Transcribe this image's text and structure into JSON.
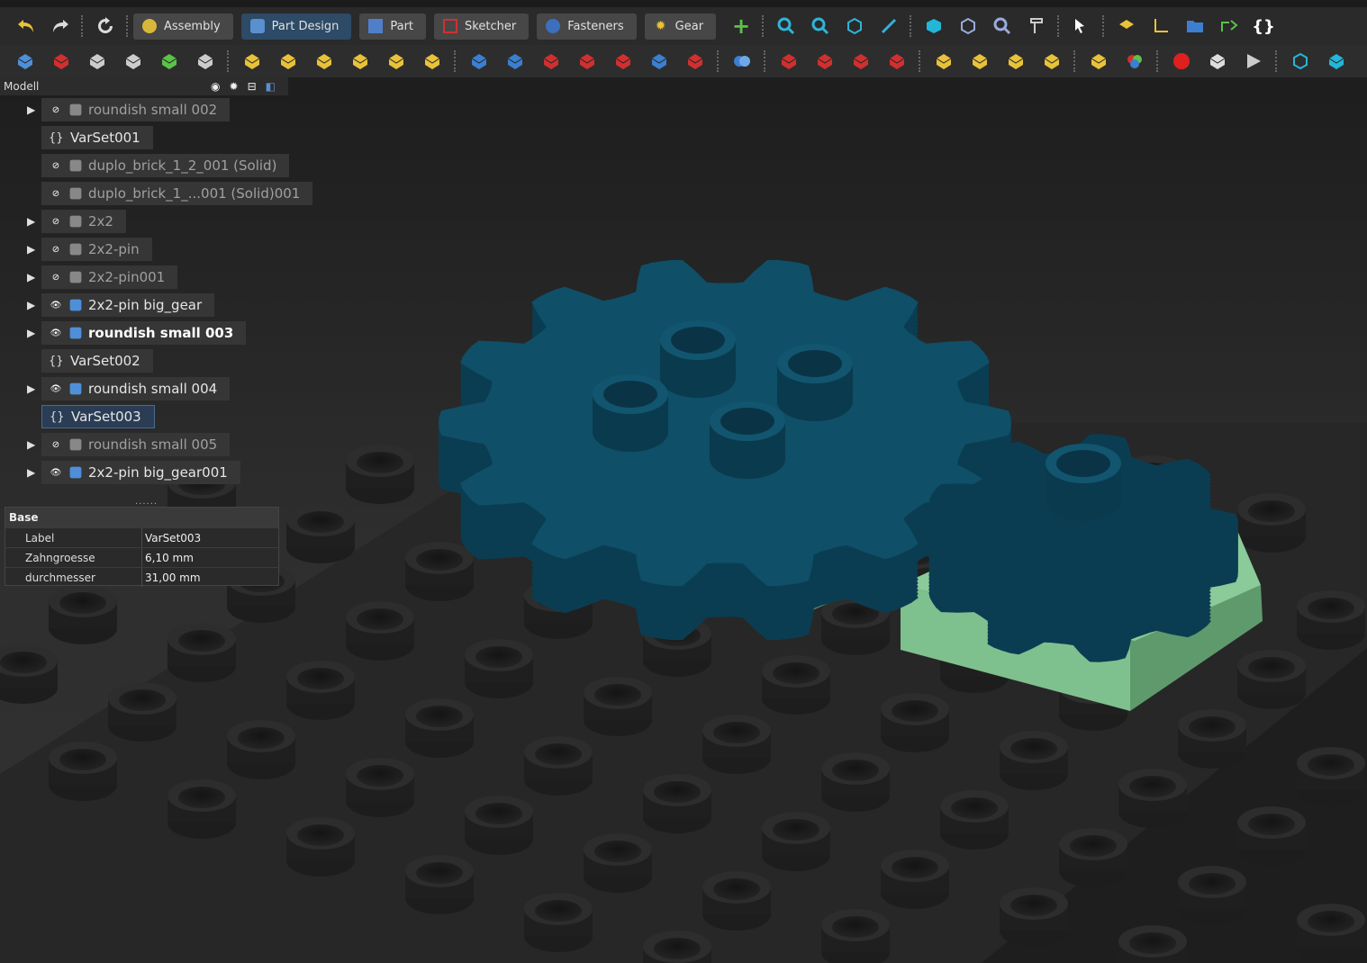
{
  "workbenches": [
    {
      "label": "Assembly",
      "active": false
    },
    {
      "label": "Part Design",
      "active": true
    },
    {
      "label": "Part",
      "active": false
    },
    {
      "label": "Sketcher",
      "active": false
    },
    {
      "label": "Fasteners",
      "active": false
    },
    {
      "label": "Gear",
      "active": false
    }
  ],
  "panel": {
    "title": "Modell"
  },
  "tree": [
    {
      "label": "roundish small 002",
      "expandable": true,
      "visible": false,
      "style": "dim"
    },
    {
      "label": "VarSet001",
      "expandable": false,
      "type": "varset",
      "style": "normal"
    },
    {
      "label": "duplo_brick_1_2_001 (Solid)",
      "expandable": false,
      "visible": false,
      "style": "dim"
    },
    {
      "label": "duplo_brick_1_...001 (Solid)001",
      "expandable": false,
      "visible": false,
      "style": "dim"
    },
    {
      "label": "2x2",
      "expandable": true,
      "visible": false,
      "style": "dim"
    },
    {
      "label": "2x2-pin",
      "expandable": true,
      "visible": false,
      "style": "dim"
    },
    {
      "label": "2x2-pin001",
      "expandable": true,
      "visible": false,
      "style": "dim"
    },
    {
      "label": "2x2-pin big_gear",
      "expandable": true,
      "visible": true,
      "style": "normal"
    },
    {
      "label": "roundish small 003",
      "expandable": true,
      "visible": true,
      "style": "bold"
    },
    {
      "label": "VarSet002",
      "expandable": false,
      "type": "varset",
      "style": "normal"
    },
    {
      "label": "roundish small 004",
      "expandable": true,
      "visible": true,
      "style": "normal"
    },
    {
      "label": "VarSet003",
      "expandable": false,
      "type": "varset",
      "style": "normal",
      "selected": true
    },
    {
      "label": "roundish small 005",
      "expandable": true,
      "visible": false,
      "style": "dim"
    },
    {
      "label": "2x2-pin big_gear001",
      "expandable": true,
      "visible": true,
      "style": "normal"
    }
  ],
  "properties": {
    "group": "Base",
    "rows": [
      {
        "name": "Label",
        "value": "VarSet003"
      },
      {
        "name": "Zahngroesse",
        "value": "6,10 mm"
      },
      {
        "name": "durchmesser",
        "value": "31,00 mm"
      }
    ]
  },
  "colors": {
    "gear": "#0f4f68",
    "brick": "#7fc08f",
    "plate": "#262626",
    "selection": "#2a3d55"
  }
}
